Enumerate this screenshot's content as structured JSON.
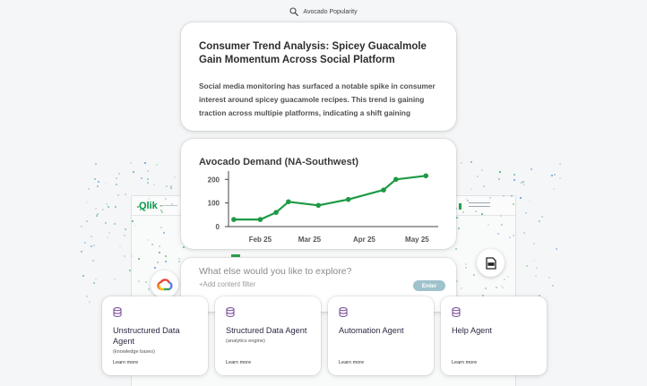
{
  "search": {
    "label": "Avocado Popularity"
  },
  "background_app": {
    "logo_text": "Qlik"
  },
  "news_card": {
    "title": "Consumer Trend Analysis: Spicey Guacalmole Gain Momentum Across Social Platform",
    "body": "Social media monitoring has surfaced a notable spike in consumer interest around spicey guacamole recipes. This trend is gaining traction across multipie platforms, indicating a shift gaining"
  },
  "chart_card": {
    "title": "Avocado Demand (NA-Southwest)"
  },
  "chart_data": {
    "type": "line",
    "title": "Avocado Demand (NA-Southwest)",
    "xlabel": "",
    "ylabel": "",
    "x_tick_labels": [
      "Feb 25",
      "Mar 25",
      "Apr 25",
      "May 25"
    ],
    "y_ticks": [
      0,
      100,
      200
    ],
    "ylim": [
      0,
      220
    ],
    "color": "#1e9a45",
    "grid": false,
    "points": [
      {
        "x": "2025-01-31",
        "y": 30
      },
      {
        "x": "2025-02-15",
        "y": 30
      },
      {
        "x": "2025-02-24",
        "y": 60
      },
      {
        "x": "2025-03-03",
        "y": 105
      },
      {
        "x": "2025-03-20",
        "y": 90
      },
      {
        "x": "2025-04-06",
        "y": 115
      },
      {
        "x": "2025-04-26",
        "y": 155
      },
      {
        "x": "2025-05-03",
        "y": 200
      },
      {
        "x": "2025-05-20",
        "y": 215
      }
    ]
  },
  "explore": {
    "question": "What else would you like to explore?",
    "add_filter": "+Add content filter",
    "enter_label": "Enter"
  },
  "icons": {
    "search": "search-icon",
    "google_cloud": "google-cloud-icon",
    "document": "document-icon",
    "database": "database-icon"
  },
  "colors": {
    "accent_green": "#1e9a45",
    "agent_icon": "#6e3f8e",
    "enter_button": "#9fc2cc"
  },
  "agents": [
    {
      "title": "Unstructured Data Agent",
      "subtitle": "(knowledge bases)",
      "link": "Learn more"
    },
    {
      "title": "Structured Data Agent",
      "subtitle": "(analytics engine)",
      "link": "Learn more"
    },
    {
      "title": "Automation Agent",
      "subtitle": "",
      "link": "Learn more"
    },
    {
      "title": "Help Agent",
      "subtitle": "",
      "link": "Learn more"
    }
  ]
}
